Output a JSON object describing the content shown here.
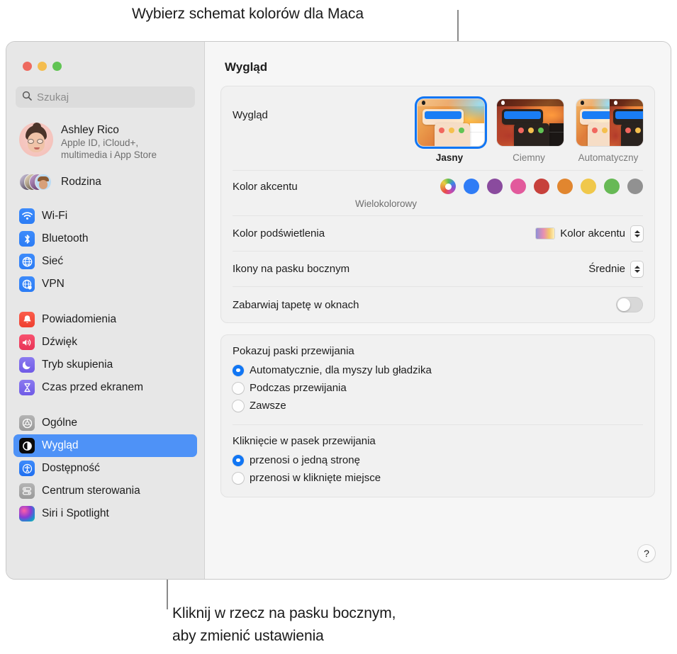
{
  "callouts": {
    "top": "Wybierz schemat kolorów dla Maca",
    "bottom_line1": "Kliknij w rzecz na pasku bocznym,",
    "bottom_line2": "aby zmienić ustawienia"
  },
  "window": {
    "traffic_lights": [
      "close-red",
      "minimize-yellow",
      "zoom-green"
    ]
  },
  "sidebar": {
    "search": {
      "placeholder": "Szukaj",
      "value": "",
      "icon": "search-icon"
    },
    "account": {
      "name": "Ashley Rico",
      "subtitle": "Apple ID, iCloud+,\nmultimedia i App Store",
      "avatar": "memoji-avatar"
    },
    "family": {
      "label": "Rodzina",
      "avatar": "family-avatar-stack"
    },
    "groups": [
      {
        "items": [
          {
            "label": "Wi-Fi",
            "icon": "wifi-icon",
            "selected": false
          },
          {
            "label": "Bluetooth",
            "icon": "bluetooth-icon",
            "selected": false
          },
          {
            "label": "Sieć",
            "icon": "network-globe-icon",
            "selected": false
          },
          {
            "label": "VPN",
            "icon": "vpn-globe-icon",
            "selected": false
          }
        ]
      },
      {
        "items": [
          {
            "label": "Powiadomienia",
            "icon": "notifications-bell-icon",
            "selected": false
          },
          {
            "label": "Dźwięk",
            "icon": "sound-speaker-icon",
            "selected": false
          },
          {
            "label": "Tryb skupienia",
            "icon": "focus-moon-icon",
            "selected": false
          },
          {
            "label": "Czas przed ekranem",
            "icon": "screen-time-hourglass-icon",
            "selected": false
          }
        ]
      },
      {
        "items": [
          {
            "label": "Ogólne",
            "icon": "general-gear-icon",
            "selected": false
          },
          {
            "label": "Wygląd",
            "icon": "appearance-contrast-icon",
            "selected": true
          },
          {
            "label": "Dostępność",
            "icon": "accessibility-icon",
            "selected": false
          },
          {
            "label": "Centrum sterowania",
            "icon": "control-center-icon",
            "selected": false
          },
          {
            "label": "Siri i Spotlight",
            "icon": "siri-icon",
            "selected": false
          }
        ]
      }
    ]
  },
  "main": {
    "title": "Wygląd",
    "appearance": {
      "label": "Wygląd",
      "options": [
        {
          "label": "Jasny",
          "mode": "light",
          "selected": true
        },
        {
          "label": "Ciemny",
          "mode": "dark",
          "selected": false
        },
        {
          "label": "Automatyczny",
          "mode": "auto",
          "selected": false
        }
      ]
    },
    "accent": {
      "label": "Kolor akcentu",
      "caption": "Wielokolorowy",
      "selected_index": 0,
      "swatches": [
        {
          "name": "multicolor",
          "color": "multicolor"
        },
        {
          "name": "blue",
          "color": "#2f7cf6"
        },
        {
          "name": "purple",
          "color": "#8a4b9e"
        },
        {
          "name": "pink",
          "color": "#e25a9c"
        },
        {
          "name": "red",
          "color": "#c7413c"
        },
        {
          "name": "orange",
          "color": "#e1862f"
        },
        {
          "name": "yellow",
          "color": "#f0c84b"
        },
        {
          "name": "green",
          "color": "#67b955"
        },
        {
          "name": "graphite",
          "color": "#919191"
        }
      ]
    },
    "highlight": {
      "label": "Kolor podświetlenia",
      "value": "Kolor akcentu",
      "swatch": "accent-gradient-swatch"
    },
    "sidebar_icons": {
      "label": "Ikony na pasku bocznym",
      "value": "Średnie"
    },
    "wallpaper_tint": {
      "label": "Zabarwiaj tapetę w oknach",
      "value": "off"
    },
    "scrollbars": {
      "title": "Pokazuj paski przewijania",
      "options": [
        {
          "label": "Automatycznie, dla myszy lub gładzika",
          "selected": true
        },
        {
          "label": "Podczas przewijania",
          "selected": false
        },
        {
          "label": "Zawsze",
          "selected": false
        }
      ]
    },
    "scrollbar_click": {
      "title": "Kliknięcie w pasek przewijania",
      "options": [
        {
          "label": "przenosi o jedną stronę",
          "selected": true
        },
        {
          "label": "przenosi w kliknięte miejsce",
          "selected": false
        }
      ]
    },
    "help": {
      "label": "?",
      "icon": "help-question-icon"
    }
  },
  "colors": {
    "accent_blue": "#1176f4",
    "selection_blue": "#4e92f7",
    "sidebar_bg": "#e7e7e7",
    "pane_bg": "#f6f6f6",
    "card_bg": "#f1f1f1"
  }
}
